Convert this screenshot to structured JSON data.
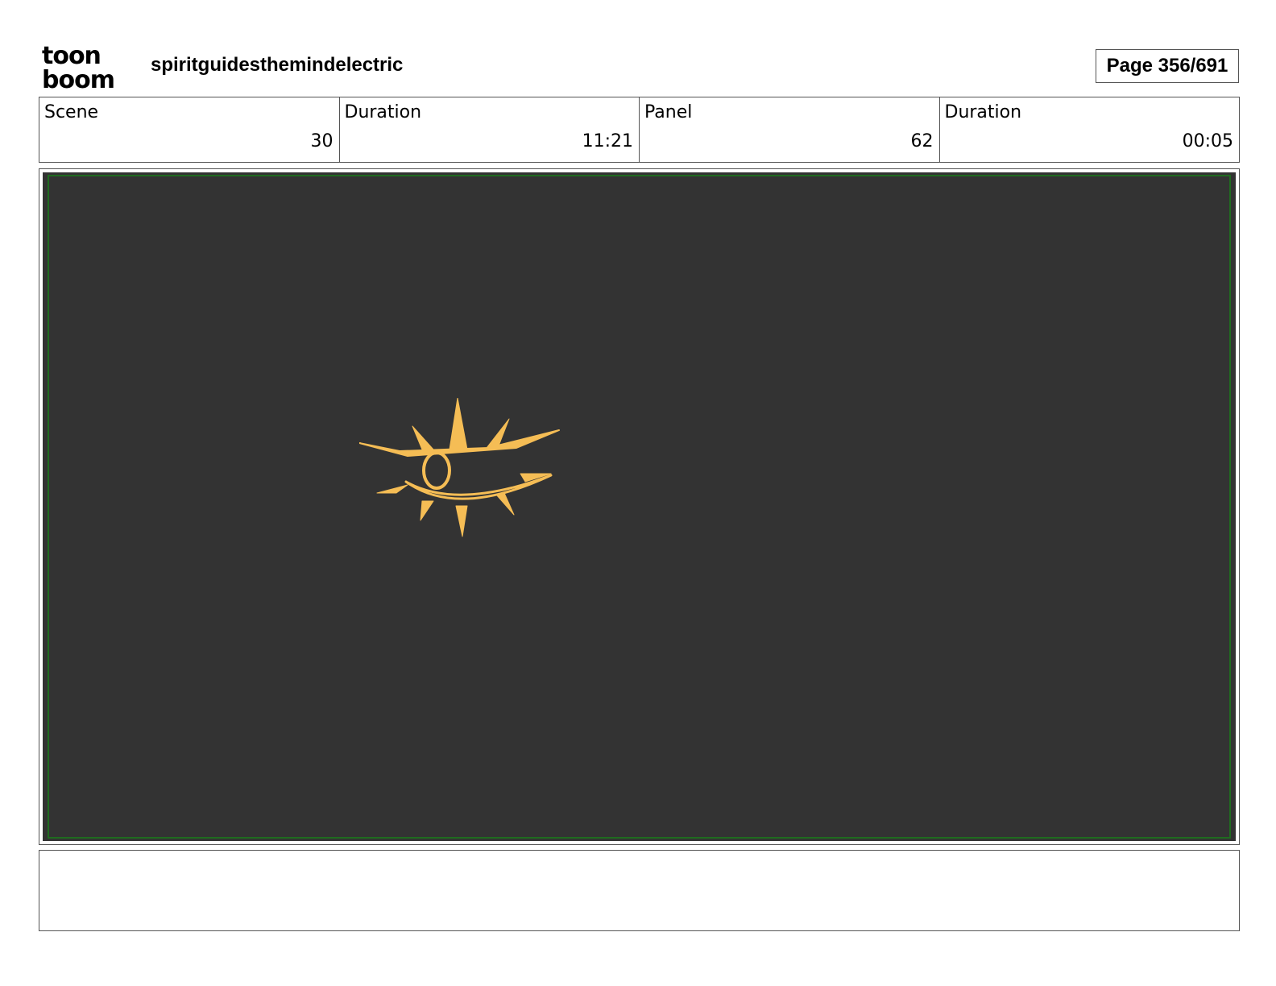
{
  "header": {
    "logo_line1": "toon",
    "logo_line2": "boom",
    "project_title": "spiritguidesthemindelectric",
    "page_label": "Page 356/691"
  },
  "info": {
    "scene_label": "Scene",
    "scene_value": "30",
    "scene_duration_label": "Duration",
    "scene_duration_value": "11:21",
    "panel_label": "Panel",
    "panel_value": "62",
    "panel_duration_label": "Duration",
    "panel_duration_value": "00:05"
  },
  "panel": {
    "background_color": "#333333",
    "safe_frame_color": "#1f6b1f",
    "drawing_color": "#f5bd55",
    "drawing_icon": "eye-sun-icon"
  },
  "notes": {
    "text": ""
  }
}
